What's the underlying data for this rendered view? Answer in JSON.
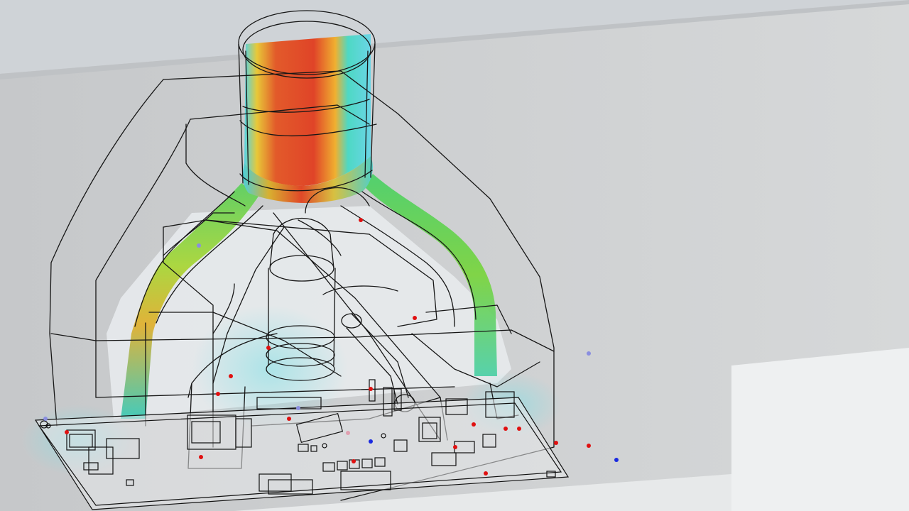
{
  "viewport": {
    "scene_type": "cfd-airflow-simulation-3d",
    "colors": {
      "background_light": "#c9cbcd",
      "background_dark": "#d3d5d6",
      "floor": "#f0f1f2",
      "wireframe": "#1a1a1a",
      "flow_high": "#e0452a",
      "flow_mid": "#f0d020",
      "flow_low": "#2cc8b0",
      "flow_min": "#59d3e8",
      "particle_red": "#e01010",
      "particle_blue": "#1a2ae0",
      "particle_lavender": "#8a8ee0"
    }
  }
}
